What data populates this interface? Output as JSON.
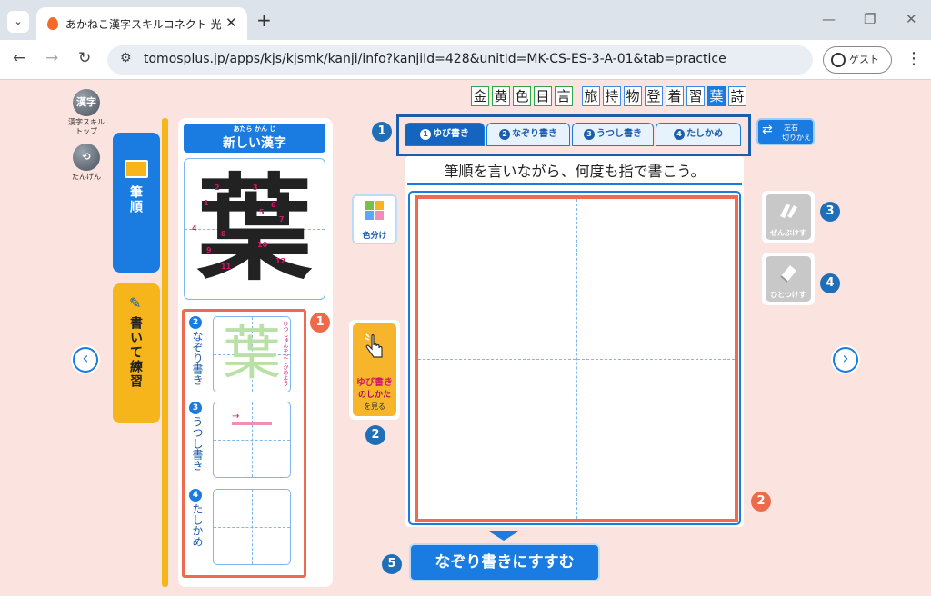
{
  "browser": {
    "tab_title": "あかねこ漢字スキルコネクト 光村図書",
    "url": "tomosplus.jp/apps/kjs/kjsmk/kanji/info?kanjiId=428&unitId=MK-CS-ES-3-A-01&tab=practice",
    "guest_label": "ゲスト"
  },
  "kanji_sets": {
    "group1": [
      "金",
      "黄",
      "色",
      "目",
      "言"
    ],
    "group2": [
      "旅",
      "持",
      "物",
      "登",
      "着",
      "習",
      "葉",
      "詩"
    ],
    "current": "葉"
  },
  "top_left": {
    "kanji_top_icon": "漢字",
    "kanji_top_label": "漢字スキルトップ",
    "back_label": "たんげん"
  },
  "side_tabs": {
    "hitsujun": "筆順",
    "hitsujun_ruby": "ひつじゅん",
    "kaite": "書いて練習",
    "kaite_ruby": "か れんしゅう"
  },
  "left_panel": {
    "header": "新しい漢字",
    "header_ruby": "あたら かん じ",
    "kanji": "葉",
    "stroke_numbers": [
      "1",
      "2",
      "3",
      "4",
      "5",
      "6",
      "7",
      "8",
      "9",
      "10",
      "11",
      "12"
    ],
    "rows": [
      {
        "num": "2",
        "label": "なぞり書き"
      },
      {
        "num": "3",
        "label": "うつし書き"
      },
      {
        "num": "4",
        "label": "たしかめ"
      }
    ],
    "trace_note": "ひつじゅんをたしかめよう"
  },
  "left_tools": {
    "color_label": "色分け",
    "finger_title": "ゆび書き",
    "finger_sub": "のしかた",
    "finger_see": "を見る"
  },
  "practice_tabs": [
    {
      "num": "1",
      "label": "ゆび書き",
      "active": true
    },
    {
      "num": "2",
      "label": "なぞり書き",
      "active": false
    },
    {
      "num": "3",
      "label": "うつし書き",
      "active": false
    },
    {
      "num": "4",
      "label": "たしかめ",
      "active": false
    }
  ],
  "swap_button": {
    "line1": "左右",
    "line2": "切りかえ"
  },
  "instruction": "筆順を言いながら、何度も指で書こう。",
  "tools": {
    "erase_all": "ぜんぶけす",
    "erase_one": "ひとつけす"
  },
  "next_button": "なぞり書きにすすむ",
  "badges": {
    "b1": "1",
    "b2": "2",
    "b3": "3",
    "b4": "4",
    "b5": "5",
    "o1": "1",
    "o2": "2"
  },
  "colors": {
    "accent": "#1a7be0",
    "highlight": "#ee6a50",
    "side_yellow": "#f5b51b",
    "background": "#fbe3e0"
  }
}
